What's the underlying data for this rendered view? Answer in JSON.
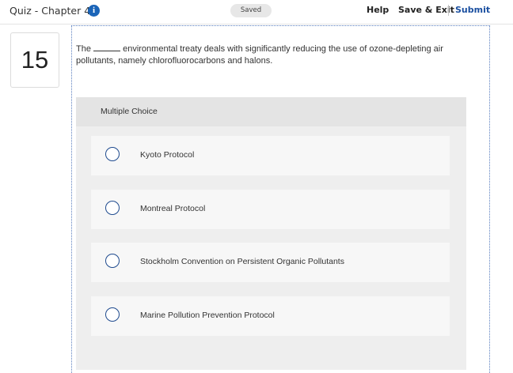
{
  "header": {
    "quiz_title": "Quiz - Chapter 46",
    "info_icon": "info-icon",
    "status": "Saved",
    "help_label": "Help",
    "save_exit_label": "Save & Exit",
    "submit_label": "Submit"
  },
  "question": {
    "number": "15",
    "text_before_blank": "The",
    "text_after_blank": "environmental treaty deals with significantly reducing the use of ozone-depleting air pollutants, namely chlorofluorocarbons and halons."
  },
  "multiple_choice": {
    "label": "Multiple Choice",
    "options": [
      {
        "label": "Kyoto Protocol"
      },
      {
        "label": "Montreal Protocol"
      },
      {
        "label": "Stockholm Convention on Persistent Organic Pollutants"
      },
      {
        "label": "Marine Pollution Prevention Protocol"
      }
    ]
  },
  "colors": {
    "accent": "#1a64b8",
    "submit": "#1a4fa0",
    "radio_border": "#1e4a8e"
  }
}
